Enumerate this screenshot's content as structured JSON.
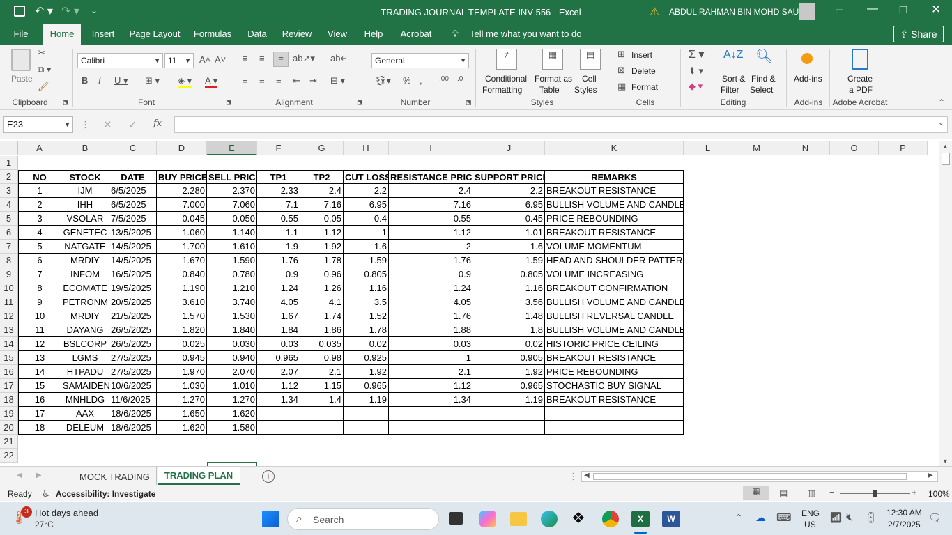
{
  "title_bar": {
    "title": "TRADING JOURNAL TEMPLATE INV 556  -  Excel",
    "user": "ABDUL RAHMAN BIN MOHD SAUPI",
    "warning_icon": "warning-icon"
  },
  "ribbon_tabs": [
    "File",
    "Home",
    "Insert",
    "Page Layout",
    "Formulas",
    "Data",
    "Review",
    "View",
    "Help",
    "Acrobat"
  ],
  "active_tab": "Home",
  "tell_me": "Tell me what you want to do",
  "share_label": "Share",
  "ribbon": {
    "clipboard": {
      "paste": "Paste",
      "label": "Clipboard"
    },
    "font": {
      "name": "Calibri",
      "size": "11",
      "label": "Font"
    },
    "alignment": {
      "label": "Alignment"
    },
    "number": {
      "format": "General",
      "label": "Number"
    },
    "styles": {
      "conditional": "Conditional",
      "conditional2": "Formatting",
      "format_as": "Format as",
      "format_as2": "Table",
      "cell": "Cell",
      "cell2": "Styles",
      "label": "Styles"
    },
    "cells": {
      "insert": "Insert",
      "delete": "Delete",
      "format": "Format",
      "label": "Cells"
    },
    "editing": {
      "sort": "Sort &",
      "sort2": "Filter",
      "find": "Find &",
      "find2": "Select",
      "label": "Editing"
    },
    "addins": {
      "btn": "Add-ins",
      "label": "Add-ins"
    },
    "acrobat": {
      "create": "Create",
      "create2": "a PDF",
      "label": "Adobe Acrobat"
    }
  },
  "formula_bar": {
    "name_box": "E23",
    "fx": "fx",
    "value": ""
  },
  "columns": [
    "A",
    "B",
    "C",
    "D",
    "E",
    "F",
    "G",
    "H",
    "I",
    "J",
    "K",
    "L",
    "M",
    "N",
    "O",
    "P"
  ],
  "selected_column": "E",
  "rows": [
    "1",
    "2",
    "3",
    "4",
    "5",
    "6",
    "7",
    "8",
    "9",
    "10",
    "11",
    "12",
    "13",
    "14",
    "15",
    "16",
    "17",
    "18",
    "19",
    "20",
    "21",
    "22"
  ],
  "table": {
    "headers": [
      "NO",
      "STOCK",
      "DATE",
      "BUY PRICE",
      "SELL PRICE",
      "TP1",
      "TP2",
      "CUT LOSS",
      "RESISTANCE PRICE",
      "SUPPORT PRICE",
      "REMARKS"
    ],
    "data": [
      [
        "1",
        "IJM",
        "6/5/2025",
        "2.280",
        "2.370",
        "2.33",
        "2.4",
        "2.2",
        "2.4",
        "2.2",
        "BREAKOUT RESISTANCE"
      ],
      [
        "2",
        "IHH",
        "6/5/2025",
        "7.000",
        "7.060",
        "7.1",
        "7.16",
        "6.95",
        "7.16",
        "6.95",
        "BULLISH VOLUME AND CANDLE"
      ],
      [
        "3",
        "VSOLAR",
        "7/5/2025",
        "0.045",
        "0.050",
        "0.55",
        "0.05",
        "0.4",
        "0.55",
        "0.45",
        "PRICE REBOUNDING"
      ],
      [
        "4",
        "GENETEC",
        "13/5/2025",
        "1.060",
        "1.140",
        "1.1",
        "1.12",
        "1",
        "1.12",
        "1.01",
        "BREAKOUT RESISTANCE"
      ],
      [
        "5",
        "NATGATE",
        "14/5/2025",
        "1.700",
        "1.610",
        "1.9",
        "1.92",
        "1.6",
        "2",
        "1.6",
        "VOLUME MOMENTUM"
      ],
      [
        "6",
        "MRDIY",
        "14/5/2025",
        "1.670",
        "1.590",
        "1.76",
        "1.78",
        "1.59",
        "1.76",
        "1.59",
        "HEAD AND SHOULDER PATTERN"
      ],
      [
        "7",
        "INFOM",
        "16/5/2025",
        "0.840",
        "0.780",
        "0.9",
        "0.96",
        "0.805",
        "0.9",
        "0.805",
        "VOLUME INCREASING"
      ],
      [
        "8",
        "ECOMATE",
        "19/5/2025",
        "1.190",
        "1.210",
        "1.24",
        "1.26",
        "1.16",
        "1.24",
        "1.16",
        "BREAKOUT CONFIRMATION"
      ],
      [
        "9",
        "PETRONM",
        "20/5/2025",
        "3.610",
        "3.740",
        "4.05",
        "4.1",
        "3.5",
        "4.05",
        "3.56",
        "BULLISH VOLUME AND CANDLE"
      ],
      [
        "10",
        "MRDIY",
        "21/5/2025",
        "1.570",
        "1.530",
        "1.67",
        "1.74",
        "1.52",
        "1.76",
        "1.48",
        "BULLISH REVERSAL CANDLE"
      ],
      [
        "11",
        "DAYANG",
        "26/5/2025",
        "1.820",
        "1.840",
        "1.84",
        "1.86",
        "1.78",
        "1.88",
        "1.8",
        "BULLISH VOLUME AND CANDLE"
      ],
      [
        "12",
        "BSLCORP",
        "26/5/2025",
        "0.025",
        "0.030",
        "0.03",
        "0.035",
        "0.02",
        "0.03",
        "0.02",
        "HISTORIC PRICE CEILING"
      ],
      [
        "13",
        "LGMS",
        "27/5/2025",
        "0.945",
        "0.940",
        "0.965",
        "0.98",
        "0.925",
        "1",
        "0.905",
        "BREAKOUT RESISTANCE"
      ],
      [
        "14",
        "HTPADU",
        "27/5/2025",
        "1.970",
        "2.070",
        "2.07",
        "2.1",
        "1.92",
        "2.1",
        "1.92",
        "PRICE REBOUNDING"
      ],
      [
        "15",
        "SAMAIDEN",
        "10/6/2025",
        "1.030",
        "1.010",
        "1.12",
        "1.15",
        "0.965",
        "1.12",
        "0.965",
        "STOCHASTIC BUY SIGNAL"
      ],
      [
        "16",
        "MNHLDG",
        "11/6/2025",
        "1.270",
        "1.270",
        "1.34",
        "1.4",
        "1.19",
        "1.34",
        "1.19",
        "BREAKOUT RESISTANCE"
      ],
      [
        "17",
        "AAX",
        "18/6/2025",
        "1.650",
        "1.620",
        "",
        "",
        "",
        "",
        "",
        ""
      ],
      [
        "18",
        "DELEUM",
        "18/6/2025",
        "1.620",
        "1.580",
        "",
        "",
        "",
        "",
        "",
        ""
      ]
    ]
  },
  "sheet_tabs": [
    "MOCK TRADING",
    "TRADING PLAN"
  ],
  "active_sheet": "TRADING PLAN",
  "status": {
    "ready": "Ready",
    "accessibility": "Accessibility: Investigate",
    "zoom": "100%"
  },
  "taskbar": {
    "weather_title": "Hot days ahead",
    "weather_temp": "27°C",
    "weather_badge": "3",
    "search": "Search",
    "lang1": "ENG",
    "lang2": "US",
    "time": "12:30 AM",
    "date": "2/7/2025"
  }
}
